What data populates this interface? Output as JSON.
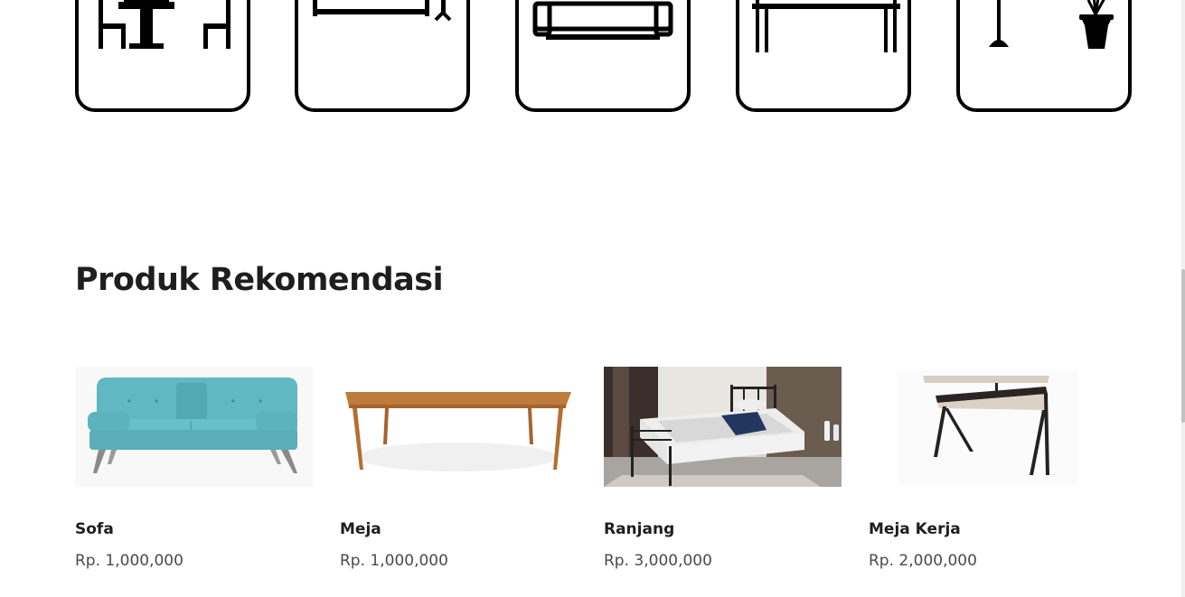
{
  "categories": [
    {
      "name": "Meja Makan",
      "icon": "dining-table-icon"
    },
    {
      "name": "Meja Belajar",
      "icon": "desk-icon"
    },
    {
      "name": "Sofa",
      "icon": "sofa-icon"
    },
    {
      "name": "Meja",
      "icon": "table-icon"
    },
    {
      "name": "Dekorasi",
      "icon": "lamp-plant-icon"
    }
  ],
  "recommendations": {
    "title": "Produk Rekomendasi",
    "products": [
      {
        "name": "Sofa",
        "price": "Rp. 1,000,000",
        "image": "sofa-image"
      },
      {
        "name": "Meja",
        "price": "Rp. 1,000,000",
        "image": "table-image"
      },
      {
        "name": "Ranjang",
        "price": "Rp. 3,000,000",
        "image": "bed-image"
      },
      {
        "name": "Meja Kerja",
        "price": "Rp. 2,000,000",
        "image": "work-desk-image"
      }
    ]
  },
  "colors": {
    "text": "#1e1e1e",
    "price": "#4a4a4a",
    "sofa": "#5fb8c2",
    "wood": "#c07a3c"
  }
}
